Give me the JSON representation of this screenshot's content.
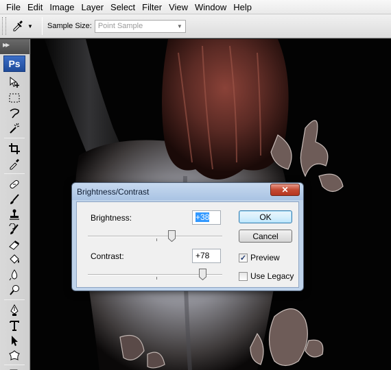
{
  "menu": [
    "File",
    "Edit",
    "Image",
    "Layer",
    "Select",
    "Filter",
    "View",
    "Window",
    "Help"
  ],
  "options": {
    "tool_icon": "eyedropper-icon",
    "sample_size_label": "Sample Size:",
    "sample_size_value": "Point Sample"
  },
  "toolbox": {
    "logo": "Ps",
    "tools": [
      "move-tool-icon",
      "marquee-tool-icon",
      "lasso-tool-icon",
      "magic-wand-icon",
      "crop-tool-icon",
      "eyedropper-icon",
      "healing-brush-icon",
      "brush-tool-icon",
      "clone-stamp-icon",
      "history-brush-icon",
      "eraser-icon",
      "paint-bucket-icon",
      "blur-tool-icon",
      "dodge-tool-icon",
      "pen-tool-icon",
      "type-tool-icon",
      "path-selection-icon",
      "custom-shape-icon",
      "notes-tool-icon"
    ]
  },
  "dialog": {
    "title": "Brightness/Contrast",
    "close": "✕",
    "brightness_label": "Brightness:",
    "brightness_value": "+38",
    "brightness_level": 38,
    "contrast_label": "Contrast:",
    "contrast_value": "+78",
    "contrast_level": 78,
    "ok_label": "OK",
    "cancel_label": "Cancel",
    "preview_label": "Preview",
    "preview_checked": true,
    "legacy_label": "Use Legacy",
    "legacy_checked": false
  },
  "colors": {
    "dialog_frame": "#a9c3e3",
    "close_button": "#c44a33",
    "selection": "#3399ff"
  }
}
